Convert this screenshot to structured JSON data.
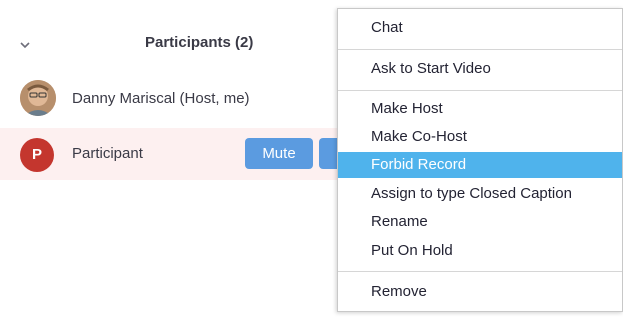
{
  "panel": {
    "title": "Participants (2)"
  },
  "participants": [
    {
      "name": "Danny Mariscal (Host, me)"
    },
    {
      "name": "Participant",
      "avatar_letter": "P",
      "mute_label": "Mute"
    }
  ],
  "menu": {
    "highlighted": "Forbid Record",
    "items": [
      "Chat",
      "Ask to Start Video",
      "Make Host",
      "Make Co-Host",
      "Forbid Record",
      "Assign to type Closed Caption",
      "Rename",
      "Put On Hold",
      "Remove"
    ]
  },
  "colors": {
    "highlight": "#4fb3ec",
    "button": "#5b9be0",
    "avatar": "#c4362e",
    "row_highlight": "#fdf0f0"
  },
  "icons": {
    "collapse": "chevron-down-icon"
  }
}
